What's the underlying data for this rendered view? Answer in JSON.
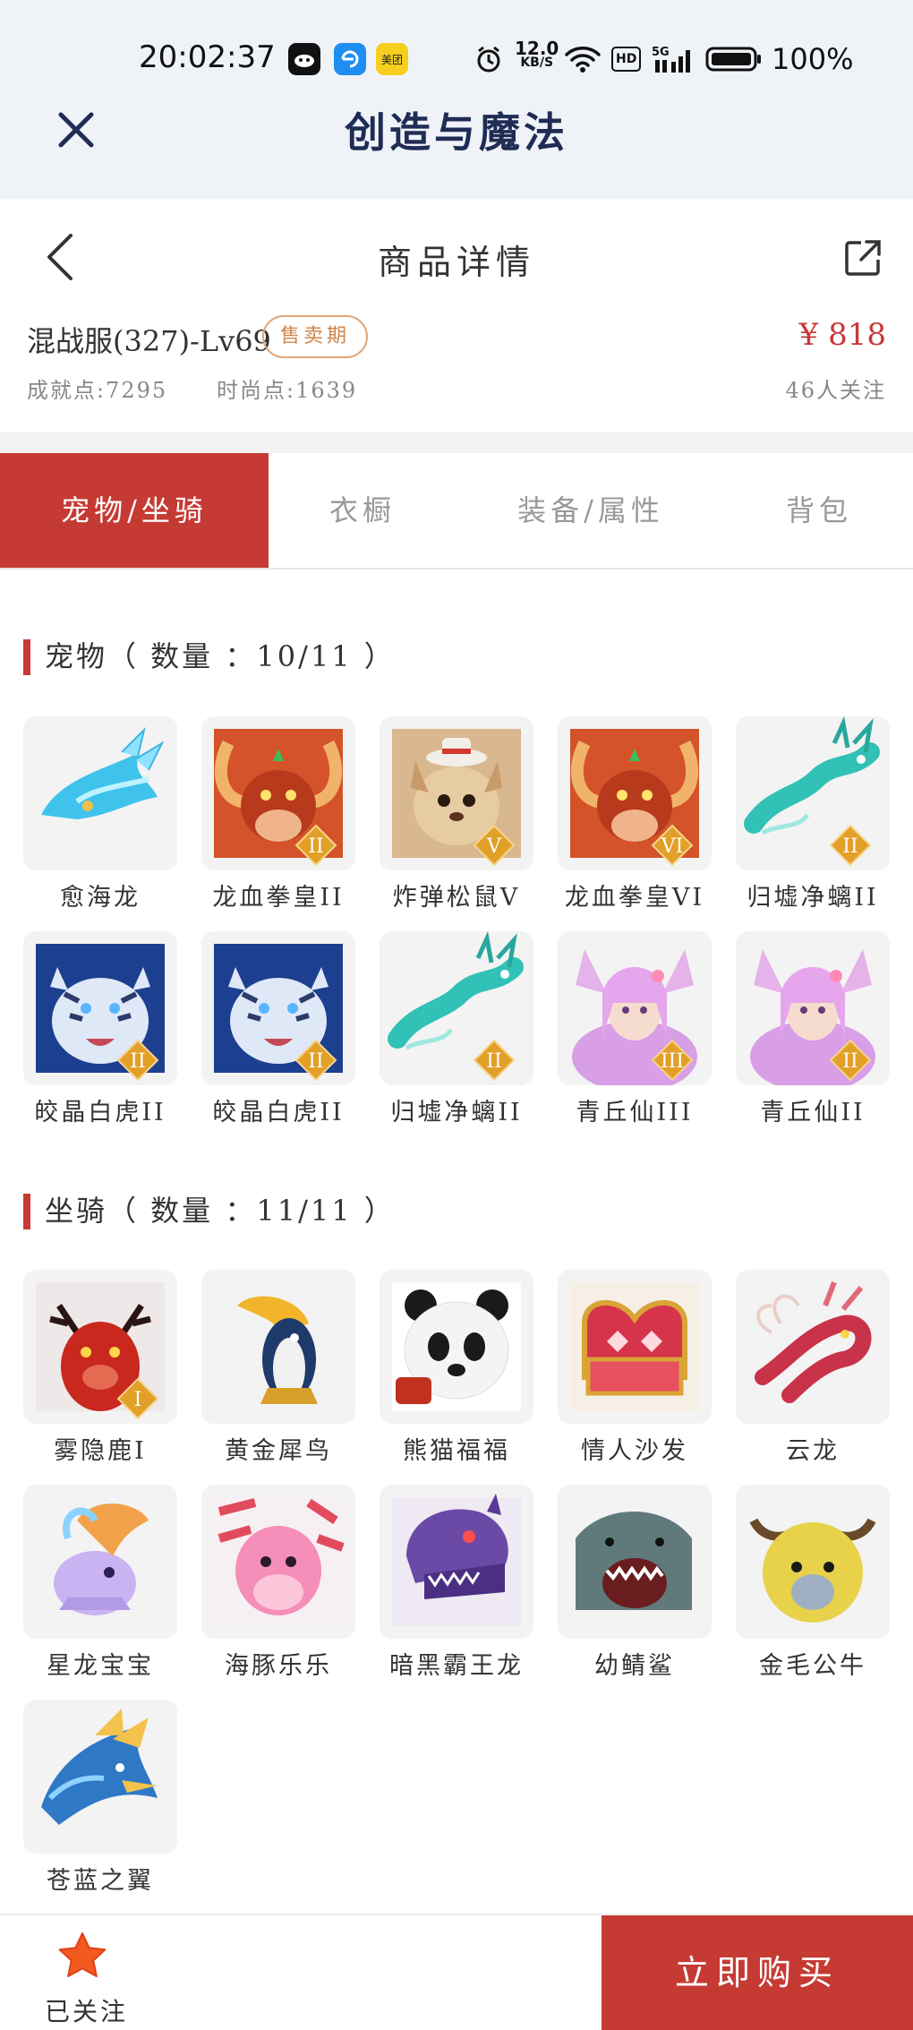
{
  "status_bar": {
    "time": "20:02:37",
    "speed_value": "12.0",
    "speed_unit": "KB/S",
    "hd": "HD",
    "network": "5G",
    "battery": "100%",
    "app3_label": "美团"
  },
  "app_header": {
    "title": "创造与魔法"
  },
  "page_nav": {
    "title": "商品详情"
  },
  "product": {
    "server": "混战服(327)-Lv69",
    "status_badge": "售卖期",
    "price": "¥ 818",
    "achievement": "成就点:7295",
    "fashion": "时尚点:1639",
    "followers": "46人关注"
  },
  "tabs": [
    {
      "label": "宠物/坐骑",
      "active": true
    },
    {
      "label": "衣橱",
      "active": false
    },
    {
      "label": "装备/属性",
      "active": false
    },
    {
      "label": "背包",
      "active": false
    }
  ],
  "pets": {
    "title": "宠物（ 数量 ：10/11 ）",
    "items": [
      {
        "name": "愈海龙",
        "icon": "cyan-sea-dragon",
        "tier": ""
      },
      {
        "name": "龙血拳皇II",
        "icon": "red-ram-beast",
        "tier": "II"
      },
      {
        "name": "炸弹松鼠V",
        "icon": "squirrel-with-hat",
        "tier": "V"
      },
      {
        "name": "龙血拳皇VI",
        "icon": "red-ram-beast",
        "tier": "VI"
      },
      {
        "name": "归墟净螭II",
        "icon": "teal-dragon",
        "tier": "II"
      },
      {
        "name": "皎晶白虎II",
        "icon": "white-tiger",
        "tier": "II"
      },
      {
        "name": "皎晶白虎II",
        "icon": "white-tiger",
        "tier": "II"
      },
      {
        "name": "归墟净螭II",
        "icon": "teal-dragon",
        "tier": "II"
      },
      {
        "name": "青丘仙III",
        "icon": "fox-fairy",
        "tier": "III"
      },
      {
        "name": "青丘仙II",
        "icon": "fox-fairy",
        "tier": "II"
      }
    ]
  },
  "mounts": {
    "title": "坐骑（ 数量 ：11/11 ）",
    "items": [
      {
        "name": "雾隐鹿I",
        "icon": "red-deer",
        "tier": "I"
      },
      {
        "name": "黄金犀鸟",
        "icon": "hornbill",
        "tier": ""
      },
      {
        "name": "熊猫福福",
        "icon": "panda",
        "tier": ""
      },
      {
        "name": "情人沙发",
        "icon": "heart-sofa",
        "tier": ""
      },
      {
        "name": "云龙",
        "icon": "cloud-dragon",
        "tier": ""
      },
      {
        "name": "星龙宝宝",
        "icon": "star-dragon-baby",
        "tier": ""
      },
      {
        "name": "海豚乐乐",
        "icon": "pink-dolphin",
        "tier": ""
      },
      {
        "name": "暗黑霸王龙",
        "icon": "purple-trex",
        "tier": ""
      },
      {
        "name": "幼鲭鲨",
        "icon": "shark",
        "tier": ""
      },
      {
        "name": "金毛公牛",
        "icon": "golden-bull",
        "tier": ""
      },
      {
        "name": "苍蓝之翼",
        "icon": "blue-griffin",
        "tier": ""
      }
    ]
  },
  "bottom_bar": {
    "follow_label": "已关注",
    "buy_label": "立即购买"
  },
  "colors": {
    "accent": "#c63a34",
    "header_bg": "#eff3f7",
    "title_navy": "#1f2c55",
    "badge": "#d0864a",
    "star": "#f25a1e"
  }
}
